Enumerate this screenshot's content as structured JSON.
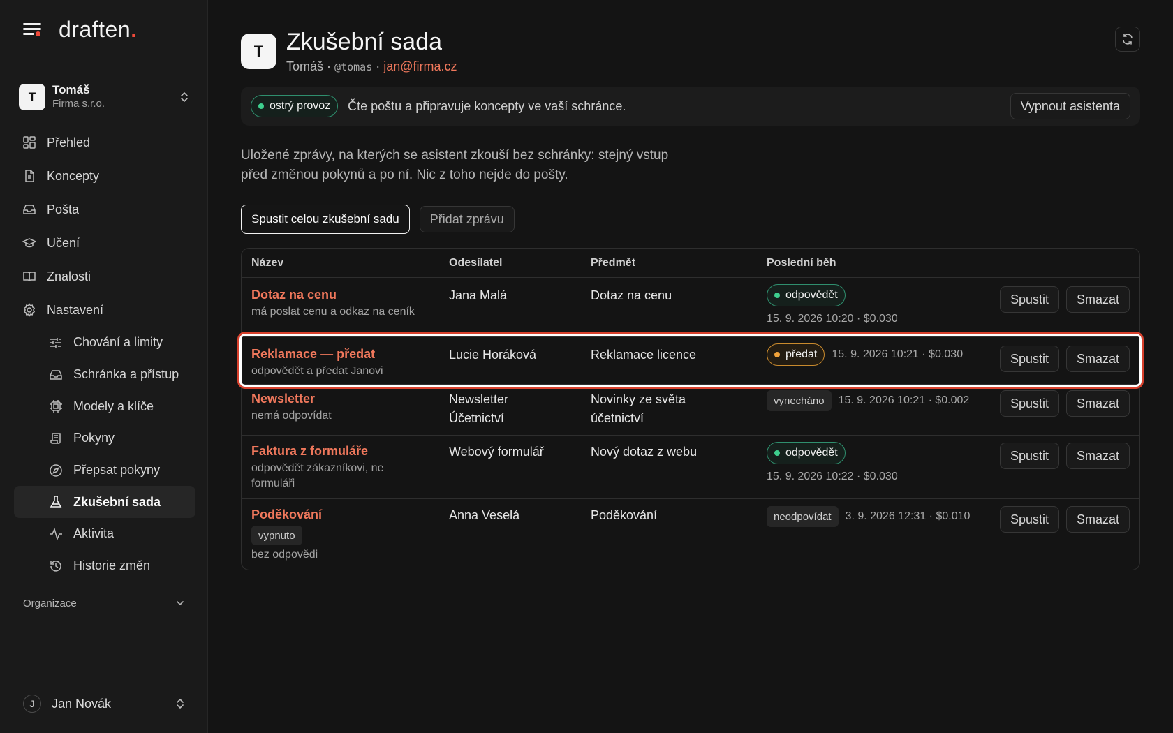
{
  "brand": {
    "name": "draften",
    "dot": "."
  },
  "account": {
    "initial": "T",
    "name": "Tomáš",
    "org": "Firma s.r.o."
  },
  "nav": {
    "items": [
      {
        "label": "Přehled",
        "icon": "grid-icon"
      },
      {
        "label": "Koncepty",
        "icon": "document-icon"
      },
      {
        "label": "Pošta",
        "icon": "inbox-icon"
      },
      {
        "label": "Učení",
        "icon": "graduation-cap-icon"
      },
      {
        "label": "Znalosti",
        "icon": "book-icon"
      },
      {
        "label": "Nastavení",
        "icon": "gear-icon"
      }
    ],
    "sub_items": [
      {
        "label": "Chování a limity",
        "icon": "sliders-icon"
      },
      {
        "label": "Schránka a přístup",
        "icon": "inbox-icon"
      },
      {
        "label": "Modely a klíče",
        "icon": "chip-icon"
      },
      {
        "label": "Pokyny",
        "icon": "scroll-icon"
      },
      {
        "label": "Přepsat pokyny",
        "icon": "compass-icon"
      },
      {
        "label": "Zkušební sada",
        "icon": "flask-icon",
        "active": true
      },
      {
        "label": "Aktivita",
        "icon": "activity-icon"
      },
      {
        "label": "Historie změn",
        "icon": "history-icon"
      }
    ],
    "org_section": "Organizace"
  },
  "user": {
    "initial": "J",
    "name": "Jan Novák"
  },
  "header": {
    "initial": "T",
    "title": "Zkušební sada",
    "name": "Tomáš",
    "sep": "·",
    "handle": "@tomas",
    "email": "jan@firma.cz"
  },
  "status": {
    "badge": "ostrý provoz",
    "text": "Čte poštu a připravuje koncepty ve vaší schránce.",
    "disable_button": "Vypnout asistenta"
  },
  "intro": "Uložené zprávy, na kterých se asistent zkouší bez schránky: stejný vstup před změnou pokynů a po ní. Nic z toho nejde do pošty.",
  "actions": {
    "run_all": "Spustit celou zkušební sadu",
    "add": "Přidat zprávu"
  },
  "table": {
    "headers": [
      "Název",
      "Odesílatel",
      "Předmět",
      "Poslední běh"
    ],
    "run_label": "Spustit",
    "delete_label": "Smazat",
    "rows": [
      {
        "name": "Dotaz na cenu",
        "desc": "má poslat cenu a odkaz na ceník",
        "sender": "Jana Malá",
        "subject": "Dotaz na cenu",
        "result": "odpovědět",
        "meta": "15. 9. 2026 10:20 · $0.030"
      },
      {
        "name": "Reklamace — předat",
        "desc": "odpovědět a předat Janovi",
        "sender": "Lucie Horáková",
        "subject": "Reklamace licence",
        "result": "předat",
        "meta": "15. 9. 2026 10:21 · $0.030"
      },
      {
        "name": "Newsletter",
        "desc": "nemá odpovídat",
        "sender": "Newsletter Účetnictví",
        "subject": "Novinky ze světa účetnictví",
        "result": "vynecháno",
        "meta": "15. 9. 2026 10:21 · $0.002"
      },
      {
        "name": "Faktura z formuláře",
        "desc": "odpovědět zákazníkovi, ne formuláři",
        "sender": "Webový formulář",
        "subject": "Nový dotaz z webu",
        "result": "odpovědět",
        "meta": "15. 9. 2026 10:22 · $0.030"
      },
      {
        "name": "Poděkování",
        "tag": "vypnuto",
        "desc": "bez odpovědi",
        "sender": "Anna Veselá",
        "subject": "Poděkování",
        "result": "neodpovídat",
        "meta": "3. 9. 2026 12:31 · $0.010"
      }
    ]
  },
  "colors": {
    "accent": "#f0785c",
    "success": "#3ecf8e",
    "warning": "#f2a33a",
    "highlight": "#d8412d"
  }
}
